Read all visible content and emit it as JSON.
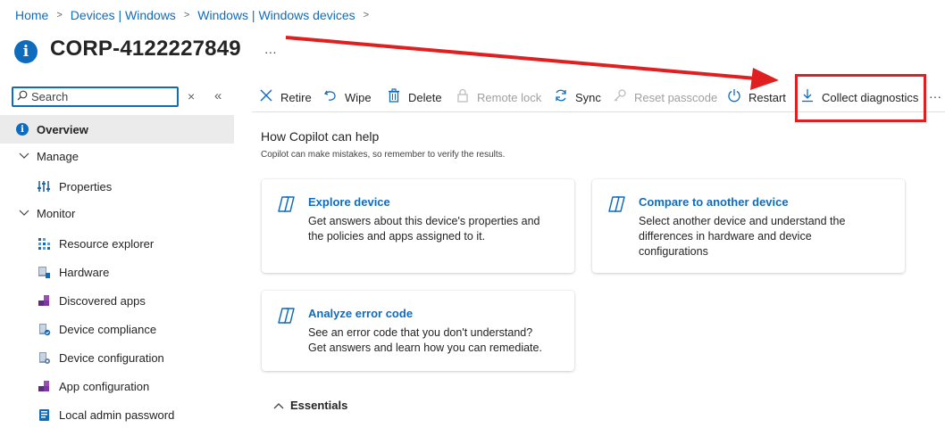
{
  "breadcrumb": {
    "items": [
      "Home",
      "Devices | Windows",
      "Windows | Windows devices"
    ],
    "separator": ">"
  },
  "header": {
    "title": "CORP-4122227849",
    "more": "···"
  },
  "sidebar": {
    "search_placeholder": "Search",
    "clear": "×",
    "collapse": "«",
    "items": [
      {
        "label": "Overview",
        "icon": "info-icon"
      },
      {
        "label": "Manage",
        "icon": "chevron-down-icon"
      },
      {
        "label": "Properties",
        "icon": "properties-icon"
      },
      {
        "label": "Monitor",
        "icon": "chevron-down-icon"
      },
      {
        "label": "Resource explorer",
        "icon": "resource-explorer-icon"
      },
      {
        "label": "Hardware",
        "icon": "hardware-icon"
      },
      {
        "label": "Discovered apps",
        "icon": "apps-icon"
      },
      {
        "label": "Device compliance",
        "icon": "compliance-icon"
      },
      {
        "label": "Device configuration",
        "icon": "configuration-icon"
      },
      {
        "label": "App configuration",
        "icon": "app-config-icon"
      },
      {
        "label": "Local admin password",
        "icon": "password-icon"
      }
    ]
  },
  "toolbar": {
    "retire": "Retire",
    "wipe": "Wipe",
    "delete": "Delete",
    "remote_lock": "Remote lock",
    "sync": "Sync",
    "reset_passcode": "Reset passcode",
    "restart": "Restart",
    "collect_diagnostics": "Collect diagnostics",
    "more": "···"
  },
  "copilot": {
    "heading": "How Copilot can help",
    "disclaimer": "Copilot can make mistakes, so remember to verify the results.",
    "cards": [
      {
        "title": "Explore device",
        "desc": [
          "Get answers about this device's properties and",
          "the policies and apps assigned to it."
        ]
      },
      {
        "title": "Compare to another device",
        "desc": [
          "Select another device and understand the",
          "differences in hardware and device",
          "configurations"
        ]
      },
      {
        "title": "Analyze error code",
        "desc": [
          "See an error code that you don't understand?",
          "Get answers and learn how you can remediate."
        ]
      }
    ]
  },
  "essentials": {
    "label": "Essentials"
  },
  "colors": {
    "accent": "#0f6cbd",
    "annotation": "#e02020",
    "active_bg": "#ebebeb"
  }
}
